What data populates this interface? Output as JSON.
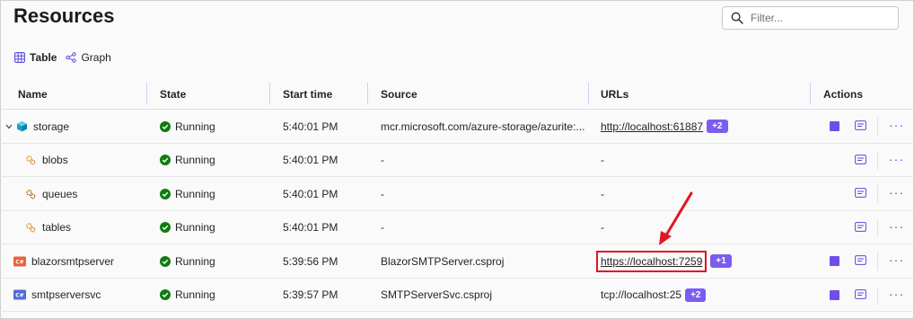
{
  "page": {
    "title": "Resources"
  },
  "filter": {
    "placeholder": "Filter..."
  },
  "view_tabs": [
    {
      "label": "Table",
      "icon": "table-icon",
      "active": true
    },
    {
      "label": "Graph",
      "icon": "graph-icon",
      "active": false
    }
  ],
  "columns": {
    "name": "Name",
    "state": "State",
    "start_time": "Start time",
    "source": "Source",
    "urls": "URLs",
    "actions": "Actions"
  },
  "rows": [
    {
      "name": "storage",
      "icon": "storage-cube-icon",
      "expanded": true,
      "state": "Running",
      "start_time": "5:40:01 PM",
      "source": "mcr.microsoft.com/azure-storage/azurite:...",
      "url": "http://localhost:61887",
      "url_badge": "+2",
      "has_stop": true
    },
    {
      "name": "blobs",
      "icon": "gear-icon",
      "child": true,
      "state": "Running",
      "start_time": "5:40:01 PM",
      "source": "-",
      "url_text": "-",
      "has_stop": false
    },
    {
      "name": "queues",
      "icon": "gear-icon",
      "child": true,
      "state": "Running",
      "start_time": "5:40:01 PM",
      "source": "-",
      "url_text": "-",
      "has_stop": false
    },
    {
      "name": "tables",
      "icon": "gear-icon",
      "child": true,
      "state": "Running",
      "start_time": "5:40:01 PM",
      "source": "-",
      "url_text": "-",
      "has_stop": false
    },
    {
      "name": "blazorsmtpserver",
      "icon": "csproj-icon",
      "state": "Running",
      "start_time": "5:39:56 PM",
      "source": "BlazorSMTPServer.csproj",
      "url": "https://localhost:7259",
      "url_badge": "+1",
      "highlighted": true,
      "has_stop": true
    },
    {
      "name": "smtpserversvc",
      "icon": "csproj-icon",
      "state": "Running",
      "start_time": "5:39:57 PM",
      "source": "SMTPServerSvc.csproj",
      "url_text": "tcp://localhost:25",
      "url_badge": "+2",
      "has_stop": true
    }
  ],
  "colors": {
    "accent": "#6e4ee6",
    "badge": "#7b5cf0",
    "running": "#107c10",
    "annotation": "#e2161f"
  }
}
